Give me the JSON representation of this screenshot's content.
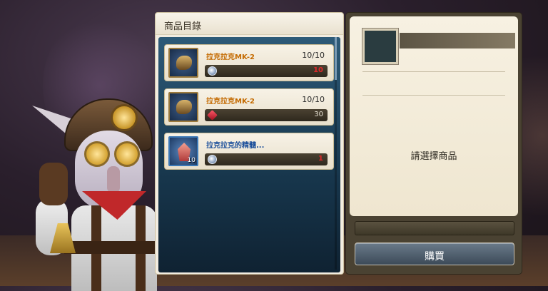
{
  "shop": {
    "title": "商品目錄",
    "items": [
      {
        "name": "拉克拉克MK-2",
        "stock": "10/10",
        "price": "10",
        "icon": "mechanical-beast-icon",
        "currency": "silver-coin-icon"
      },
      {
        "name": "拉克拉克MK-2",
        "stock": "10/10",
        "price": "30",
        "icon": "mechanical-beast-icon",
        "currency": "red-gem-icon"
      },
      {
        "name": "拉克拉克的精髓...",
        "stock": "",
        "price": "1",
        "icon": "red-crystal-icon",
        "quantity": "10",
        "currency": "silver-coin-icon"
      }
    ]
  },
  "detail": {
    "message": "請選擇商品",
    "buy_label": "購買"
  },
  "colors": {
    "item_name_orange": "#c46a00",
    "item_name_blue": "#1a4e9a",
    "price_red": "#e0282a"
  }
}
